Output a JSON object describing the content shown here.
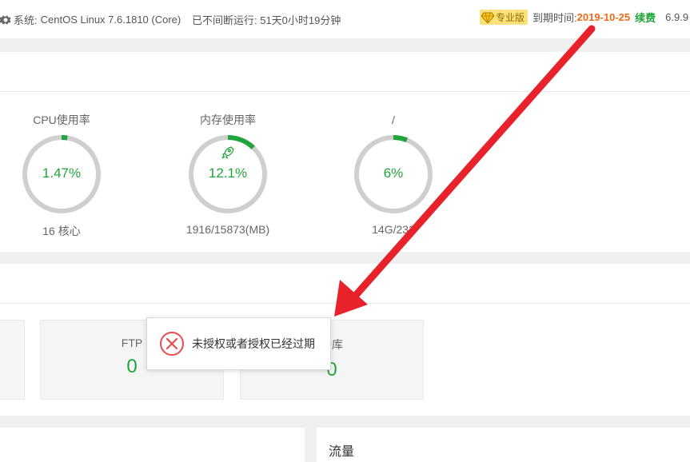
{
  "topbar": {
    "system_label": "系统:",
    "system_value": "CentOS Linux 7.6.1810 (Core)",
    "uptime": "已不间断运行: 51天0小时19分钟",
    "pro_label": "专业版",
    "expire_label": "到期时间:",
    "expire_date": "2019-10-25",
    "renew_label": "续费",
    "version": "6.9.9"
  },
  "gauges": [
    {
      "title": "CPU使用率",
      "percent_text": "1.47%",
      "percent": 1.47,
      "sub": "16 核心"
    },
    {
      "title": "内存使用率",
      "percent_text": "12.1%",
      "percent": 12.1,
      "sub": "1916/15873(MB)",
      "icon": "rocket-icon"
    },
    {
      "title": "/",
      "percent_text": "6%",
      "percent": 6,
      "sub": "14G/233"
    }
  ],
  "cards": [
    {
      "label": "FTP",
      "value": "0"
    },
    {
      "label": "据库",
      "value": "0"
    }
  ],
  "traffic_label": "流量",
  "toast": {
    "message": "未授权或者授权已经过期",
    "icon": "error-x-icon"
  },
  "colors": {
    "accent": "#20a53a",
    "warning": "#ef6a1a",
    "pro_badge": "#fbe27a",
    "error": "#e64c4c",
    "annotation_arrow": "#e8222a"
  }
}
